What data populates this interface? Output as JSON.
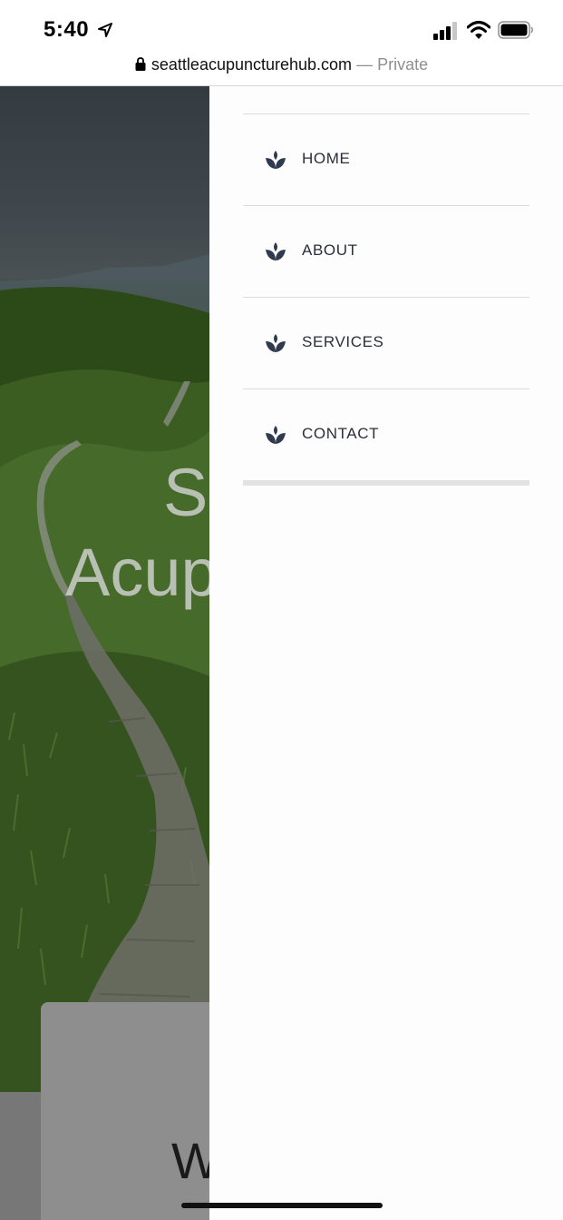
{
  "status_bar": {
    "time": "5:40",
    "location_icon": "location-arrow-icon",
    "signal_icon": "cellular-signal-icon",
    "wifi_icon": "wifi-icon",
    "battery_icon": "battery-icon"
  },
  "browser": {
    "url": "seattleacupuncturehub.com",
    "mode": " — Private",
    "lock_icon": "lock-icon"
  },
  "hero": {
    "title_line1": "S",
    "title_line2": "Acup"
  },
  "welcome": {
    "heading": "W"
  },
  "menu": {
    "item_icon": "lotus-icon",
    "icon_color": "#2f3a4f",
    "items": [
      {
        "label": "HOME"
      },
      {
        "label": "ABOUT"
      },
      {
        "label": "SERVICES"
      },
      {
        "label": "CONTACT"
      }
    ]
  }
}
